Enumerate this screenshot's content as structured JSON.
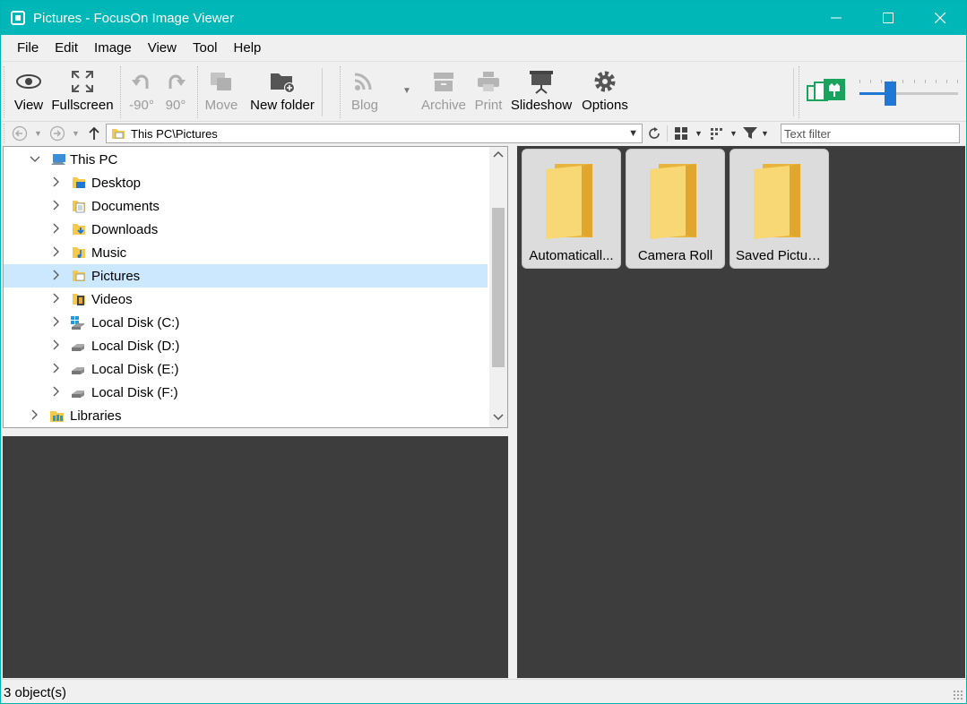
{
  "window": {
    "title": "Pictures - FocusOn Image Viewer",
    "controls": [
      "minimize",
      "maximize",
      "close"
    ]
  },
  "menu": [
    "File",
    "Edit",
    "Image",
    "View",
    "Tool",
    "Help"
  ],
  "toolbar": {
    "view": "View",
    "fullscreen": "Fullscreen",
    "rotate_left": "-90°",
    "rotate_right": "90°",
    "move": "Move",
    "new_folder": "New folder",
    "blog": "Blog",
    "archive": "Archive",
    "print": "Print",
    "slideshow": "Slideshow",
    "options": "Options"
  },
  "address": {
    "path": "This PC\\Pictures",
    "filter_placeholder": "Text filter"
  },
  "tree": {
    "items": [
      {
        "label": "This PC",
        "icon": "computer-icon",
        "expanded": true
      },
      {
        "label": "Desktop",
        "icon": "desktop-folder-icon"
      },
      {
        "label": "Documents",
        "icon": "documents-folder-icon"
      },
      {
        "label": "Downloads",
        "icon": "downloads-folder-icon"
      },
      {
        "label": "Music",
        "icon": "music-folder-icon"
      },
      {
        "label": "Pictures",
        "icon": "pictures-folder-icon",
        "selected": true
      },
      {
        "label": "Videos",
        "icon": "videos-folder-icon"
      },
      {
        "label": "Local Disk (C:)",
        "icon": "windows-drive-icon"
      },
      {
        "label": "Local Disk (D:)",
        "icon": "drive-icon"
      },
      {
        "label": "Local Disk (E:)",
        "icon": "drive-icon"
      },
      {
        "label": "Local Disk (F:)",
        "icon": "drive-icon"
      },
      {
        "label": "Libraries",
        "icon": "libraries-icon"
      }
    ]
  },
  "thumbnails": [
    {
      "label": "Automaticall..."
    },
    {
      "label": "Camera Roll"
    },
    {
      "label": "Saved Pictures"
    }
  ],
  "status": {
    "text": "3 object(s)"
  },
  "colors": {
    "titlebar": "#00b7b7",
    "selection": "#cce8ff",
    "accent": "#1e78d4",
    "panel_dark": "#3d3d3d",
    "folder": "#f5c94c"
  },
  "zoom_slider": {
    "level": 0.31
  }
}
